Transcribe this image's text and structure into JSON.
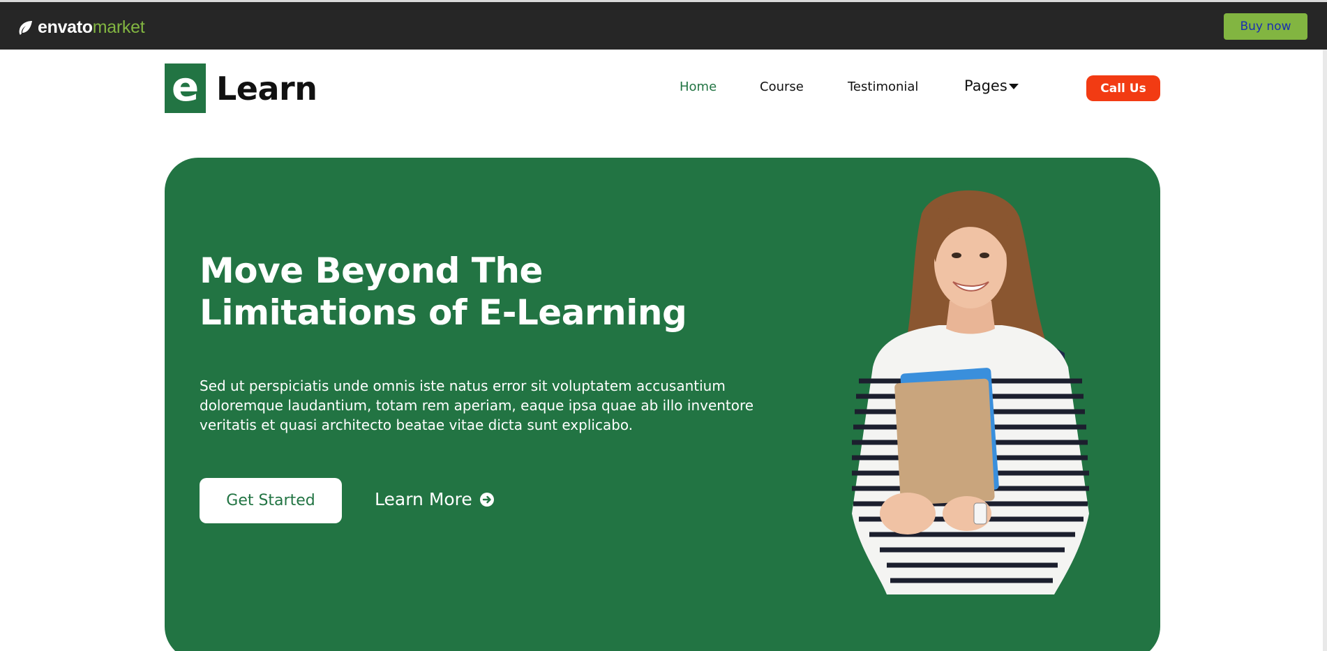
{
  "envato_bar": {
    "logo_main": "envato",
    "logo_accent": "market",
    "buy_now_label": "Buy now"
  },
  "site": {
    "logo_letter": "e",
    "logo_text": "Learn",
    "nav": {
      "home": "Home",
      "course": "Course",
      "testimonial": "Testimonial",
      "pages": "Pages"
    },
    "call_us_label": "Call Us"
  },
  "hero": {
    "title_line1": "Move Beyond The",
    "title_line2": "Limitations of E-Learning",
    "description": "Sed ut perspiciatis unde omnis iste natus error sit voluptatem accusantium doloremque laudantium, totam rem aperiam, eaque ipsa quae ab illo inventore veritatis et quasi architecto beatae vitae dicta sunt explicabo.",
    "get_started_label": "Get Started",
    "learn_more_label": "Learn More"
  },
  "colors": {
    "brand_green": "#227443",
    "accent_red": "#f23b13",
    "envato_green": "#82b541",
    "envato_bar": "#262626"
  },
  "icons": {
    "envato_leaf": "leaf-icon",
    "pages_caret": "caret-down-icon",
    "learn_more": "arrow-circle-right-icon"
  }
}
